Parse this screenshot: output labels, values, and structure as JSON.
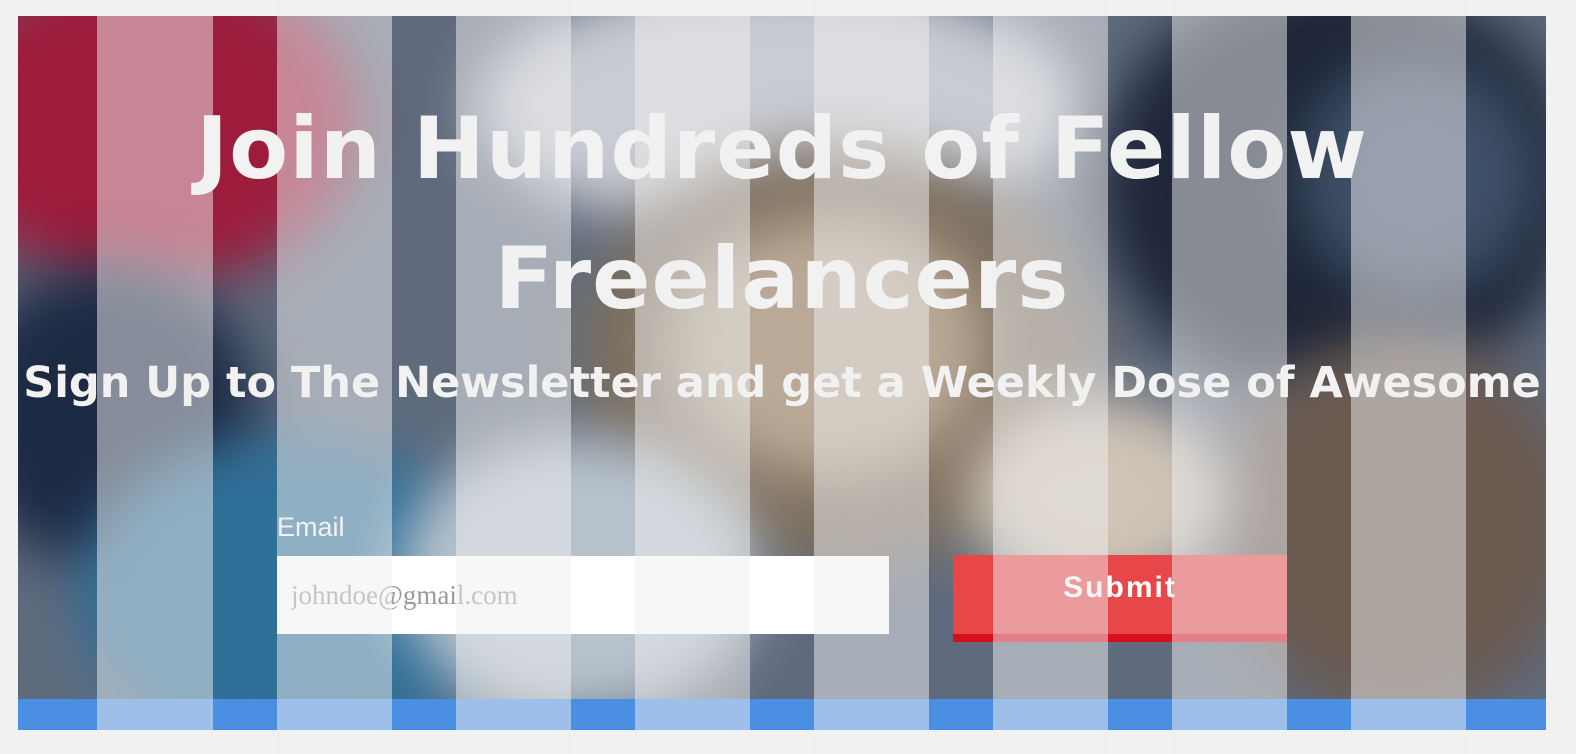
{
  "hero": {
    "title": "Join Hundreds of Fellow Freelancers",
    "subtitle": "Sign Up to The Newsletter and get a Weekly Dose of Awesome"
  },
  "form": {
    "email_label": "Email",
    "email_placeholder": "johndoe@gmail.com",
    "email_value": "",
    "submit_label": "Submit"
  },
  "colors": {
    "submit_button": "#e8474a",
    "submit_border": "#d60f1f",
    "bottom_bar": "#4a8fe2",
    "heading_text": "#f2f2f2"
  }
}
